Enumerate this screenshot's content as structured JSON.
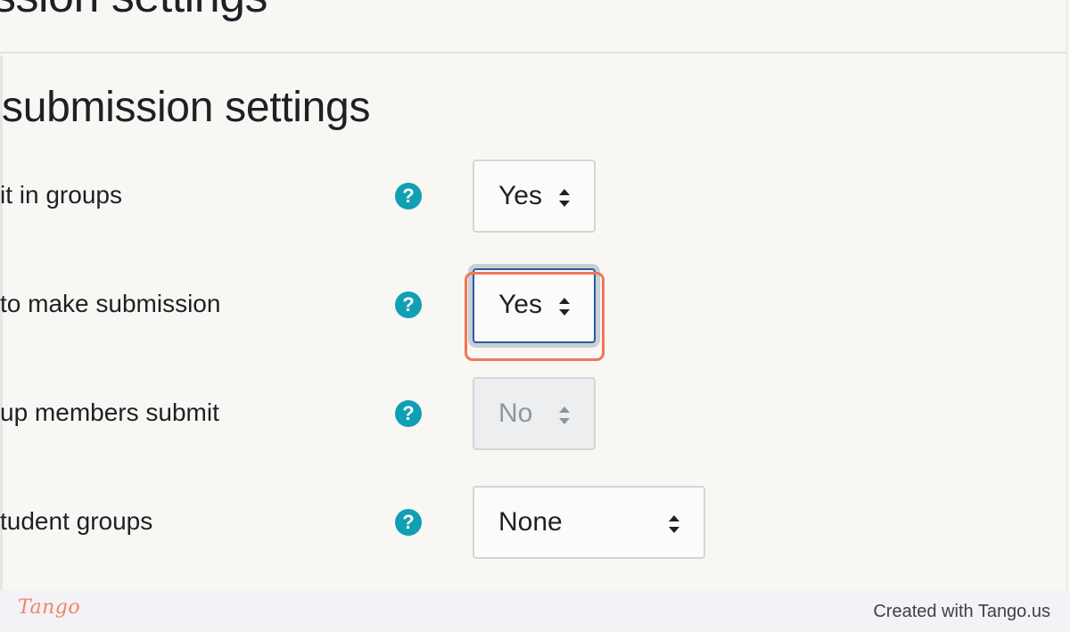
{
  "page": {
    "heading_top": "ssion settings",
    "section_title": "submission settings"
  },
  "rows": [
    {
      "label": "it in groups",
      "value": "Yes",
      "state": "normal"
    },
    {
      "label": "to make submission",
      "value": "Yes",
      "state": "focused"
    },
    {
      "label": "up members submit",
      "value": "No",
      "state": "disabled"
    },
    {
      "label": "tudent groups",
      "value": "None",
      "state": "normal"
    }
  ],
  "help_icon_glyph": "?",
  "footer": {
    "logo": "Tango",
    "credit": "Created with Tango.us"
  },
  "colors": {
    "help_icon": "#11a0b3",
    "focus_border": "#2a5aa6",
    "highlight": "#f17655",
    "brand": "#f28469"
  }
}
